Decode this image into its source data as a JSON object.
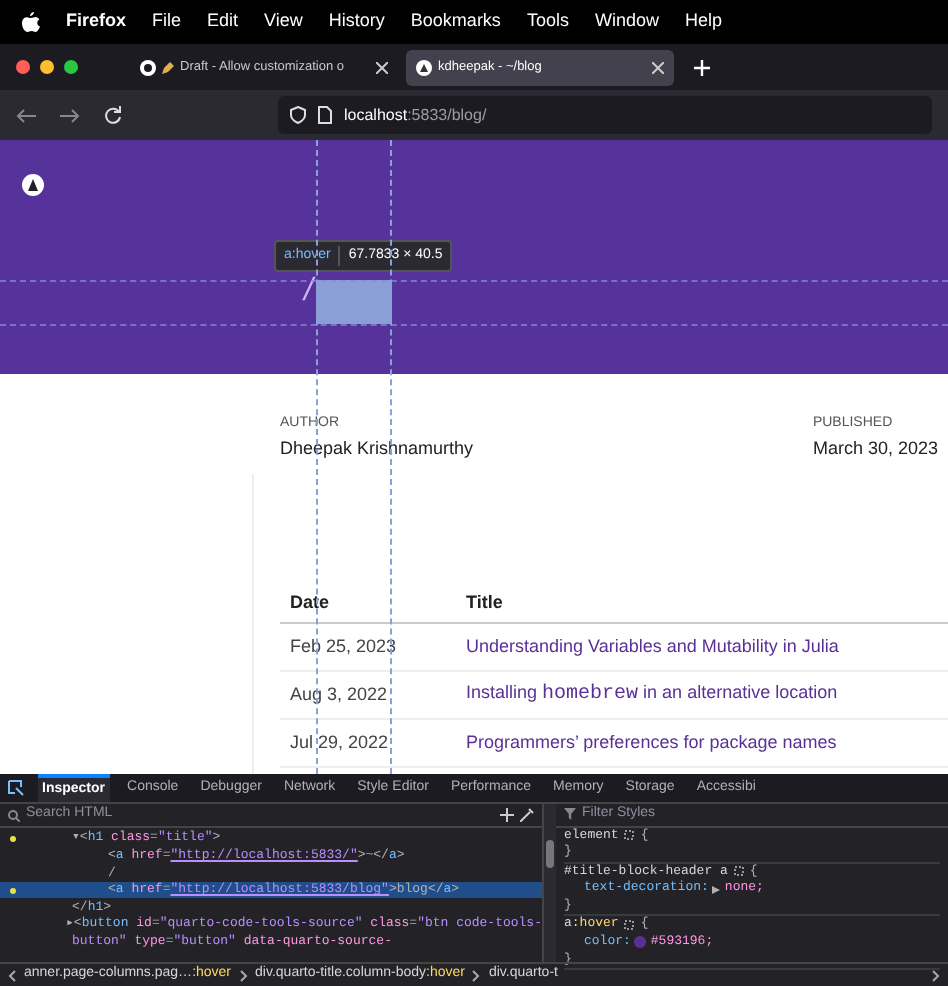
{
  "menu_bar": {
    "app": "Firefox",
    "items": [
      "File",
      "Edit",
      "View",
      "History",
      "Bookmarks",
      "Tools",
      "Window",
      "Help"
    ]
  },
  "tabs": [
    {
      "label": "Draft - Allow customization o",
      "selected": false
    },
    {
      "label": "kdheepak - ~/blog",
      "selected": true
    }
  ],
  "address": {
    "host": "localhost",
    "path": ":5833/blog/"
  },
  "highlight": {
    "separator": "/",
    "tooltip_selector": "a:hover",
    "tooltip_size": "67.7833 × 40.5"
  },
  "byline": {
    "author_label": "AUTHOR",
    "author": "Dheepak Krishnamurthy",
    "published_label": "PUBLISHED",
    "published": "March 30, 2023"
  },
  "table": {
    "columns": [
      "Date",
      "Title"
    ],
    "rows": [
      {
        "date": "Feb 25, 2023",
        "title": [
          {
            "kind": "text",
            "text": "Understanding Variables and Mutability in Julia"
          }
        ]
      },
      {
        "date": "Aug 3, 2022",
        "title": [
          {
            "kind": "text",
            "text": "Installing "
          },
          {
            "kind": "code",
            "text": "homebrew"
          },
          {
            "kind": "text",
            "text": " in an alternative location"
          }
        ]
      },
      {
        "date": "Jul 29, 2022",
        "title": [
          {
            "kind": "text",
            "text": "Programmers’ preferences for package names"
          }
        ]
      }
    ]
  },
  "devtools": {
    "tabs": [
      {
        "label": "Inspector",
        "selected": true
      },
      {
        "label": "Console",
        "selected": false
      },
      {
        "label": "Debugger",
        "selected": false
      },
      {
        "label": "Network",
        "selected": false
      },
      {
        "label": "Style Editor",
        "selected": false
      },
      {
        "label": "Performance",
        "selected": false
      },
      {
        "label": "Memory",
        "selected": false
      },
      {
        "label": "Storage",
        "selected": false
      },
      {
        "label": "Accessibi",
        "selected": false
      }
    ],
    "search_placeholder": "Search HTML",
    "html_lines": [
      {
        "marker": true,
        "selected": false,
        "segments": [
          {
            "kind": "punct",
            "text": "▾<"
          },
          {
            "kind": "tag",
            "text": "h1"
          },
          {
            "kind": "attr",
            "text": " class"
          },
          {
            "kind": "punct",
            "text": "="
          },
          {
            "kind": "value",
            "text": "\"title\""
          },
          {
            "kind": "punct",
            "text": ">"
          }
        ],
        "children": [
          {
            "marker": false,
            "selected": false,
            "segments": [
              {
                "kind": "punct",
                "text": "<"
              },
              {
                "kind": "tag",
                "text": "a"
              },
              {
                "kind": "attr",
                "text": " href"
              },
              {
                "kind": "punct",
                "text": "="
              },
              {
                "kind": "link",
                "text": "\"http://localhost:5833/\""
              },
              {
                "kind": "punct",
                "text": ">~</"
              },
              {
                "kind": "tag",
                "text": "a"
              },
              {
                "kind": "punct",
                "text": ">"
              }
            ]
          },
          {
            "marker": false,
            "selected": false,
            "segments": [
              {
                "kind": "punct",
                "text": "/"
              }
            ]
          },
          {
            "marker": true,
            "selected": true,
            "segments": [
              {
                "kind": "punct",
                "text": "<"
              },
              {
                "kind": "tag",
                "text": "a"
              },
              {
                "kind": "attr",
                "text": " href"
              },
              {
                "kind": "punct",
                "text": "="
              },
              {
                "kind": "link",
                "text": "\"http://localhost:5833/blog\""
              },
              {
                "kind": "punct",
                "text": ">blog</"
              },
              {
                "kind": "tag",
                "text": "a"
              },
              {
                "kind": "punct",
                "text": ">"
              }
            ]
          }
        ]
      },
      {
        "marker": false,
        "selected": false,
        "segments": [
          {
            "kind": "punct",
            "text": "</"
          },
          {
            "kind": "tag",
            "text": "h1"
          },
          {
            "kind": "punct",
            "text": ">"
          }
        ]
      },
      {
        "marker": false,
        "selected": false,
        "segments": [
          {
            "kind": "punct",
            "text": "▸<"
          },
          {
            "kind": "tag",
            "text": "button"
          },
          {
            "kind": "attr",
            "text": " id"
          },
          {
            "kind": "punct",
            "text": "="
          },
          {
            "kind": "value",
            "text": "\"quarto-code-tools-source\""
          },
          {
            "kind": "attr",
            "text": " class"
          },
          {
            "kind": "punct",
            "text": "="
          },
          {
            "kind": "value",
            "text": "\"btn code-tools-"
          }
        ]
      },
      {
        "marker": false,
        "selected": false,
        "segments": [
          {
            "kind": "value",
            "text": "button\""
          },
          {
            "kind": "attr",
            "text": " type"
          },
          {
            "kind": "punct",
            "text": "="
          },
          {
            "kind": "value",
            "text": "\"button\""
          },
          {
            "kind": "attr",
            "text": " data-quarto-source-"
          }
        ]
      }
    ],
    "breadcrumbs": [
      [
        {
          "kind": "text",
          "text": "anner.page-columns.pag…"
        },
        {
          "kind": "pseudo",
          "text": ":hover"
        }
      ],
      [
        {
          "kind": "text",
          "text": "div.quarto-title.column-body"
        },
        {
          "kind": "pseudo",
          "text": ":hover"
        }
      ],
      [
        {
          "kind": "text",
          "text": "div.quarto-t"
        }
      ]
    ],
    "filter_placeholder": "Filter Styles",
    "rules": [
      {
        "selector": [
          {
            "kind": "text",
            "text": "element"
          }
        ],
        "open": "{",
        "close": "}"
      },
      {
        "selector": [
          {
            "kind": "text",
            "text": "#title-block-header a"
          }
        ],
        "open": "{",
        "close": "}",
        "declarations": [
          {
            "property": "text-decoration:",
            "value": "none;",
            "expandable": true
          }
        ]
      },
      {
        "selector": [
          {
            "kind": "text",
            "text": "a"
          },
          {
            "kind": "pseudo",
            "text": ":hover"
          }
        ],
        "open": "{",
        "close": "}",
        "declarations": [
          {
            "property": "color:",
            "value": "#593196;",
            "color": "#593196"
          }
        ]
      }
    ]
  }
}
